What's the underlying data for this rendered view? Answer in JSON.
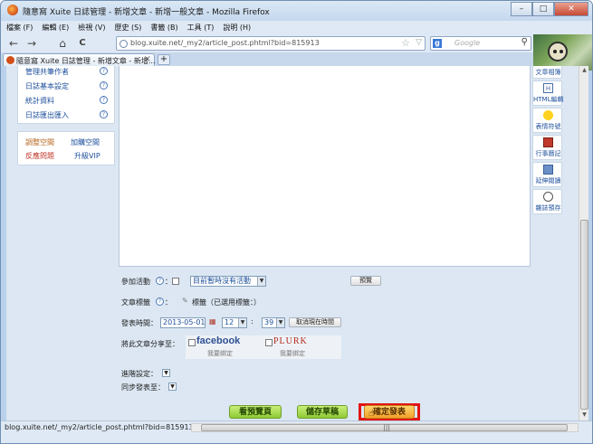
{
  "window": {
    "title": "隨意窩 Xuite 日誌管理 - 新增文章 - 新增一般文章 - Mozilla Firefox",
    "minimize": "–",
    "maximize": "□",
    "close": "✕"
  },
  "menubar": {
    "items": [
      "檔案 (F)",
      "編輯 (E)",
      "檢視 (V)",
      "歷史 (S)",
      "書籤 (B)",
      "工具 (T)",
      "說明 (H)"
    ]
  },
  "navbar": {
    "back": "←",
    "forward": "→",
    "home": "⌂",
    "reload": "C",
    "url": "blog.xuite.net/_my2/article_post.phtml?bid=815913",
    "star": "☆",
    "go": "▽",
    "search_placeholder": "Google",
    "search_engine": "g",
    "search_icon": "⚲"
  },
  "tab": {
    "label": "隨意窩 Xuite 日誌管理 - 新增文章 - 新增...",
    "close": "×",
    "new_tab": "+"
  },
  "sidebar": {
    "items": [
      {
        "label": "管理共筆作者",
        "help": "?"
      },
      {
        "label": "日誌基本設定",
        "help": "?"
      },
      {
        "label": "統計資料",
        "help": "?"
      },
      {
        "label": "日誌匯出匯入",
        "help": "?"
      }
    ],
    "space": {
      "adjust": "調整空間",
      "buy": "加購空間",
      "feedback": "反應問題",
      "vip": "升級VIP"
    }
  },
  "rightbar": {
    "items": [
      {
        "label": "文章相簿",
        "icon": "album-icon"
      },
      {
        "label": "HTML編輯",
        "icon": "html-icon"
      },
      {
        "label": "表情符號",
        "icon": "smiley-icon"
      },
      {
        "label": "行事曆記",
        "icon": "calendar-icon"
      },
      {
        "label": "延伸閱讀",
        "icon": "link-icon"
      },
      {
        "label": "雜誌預存",
        "icon": "save-icon"
      }
    ],
    "html_icon_text": "H"
  },
  "form": {
    "activity_label": "參加活動",
    "activity_select": "目前暫時沒有活動",
    "preview_small": "預覽",
    "tags_label": "文章標籤",
    "tags_value": "標籤（已選用標籤：）",
    "publish_label": "發表時間：",
    "publish_date": "2013-05-01",
    "publish_hour": "12",
    "publish_minute": "39",
    "time_sep": ":",
    "cancel_time": "取消現在時間",
    "share_label": "將此文章分享至：",
    "facebook": "facebook",
    "facebook_note": "我要綁定",
    "plurk": "PLURK",
    "plurk_note": "我要綁定",
    "advanced_label": "進階設定：",
    "sync_label": "同步發表至：",
    "help": "?",
    "colon": "："
  },
  "actions": {
    "preview": "看預覽頁",
    "draft": "儲存草稿",
    "publish": "確定發表"
  },
  "status": {
    "text": "blog.xuite.net/_my2/article_post.phtml?bid=815913#",
    "grip": "|||"
  },
  "colors": {
    "accent_red": "#e21414",
    "link_blue": "#1d4f9c",
    "facebook": "#2d4f93",
    "plurk": "#b52a1d"
  }
}
